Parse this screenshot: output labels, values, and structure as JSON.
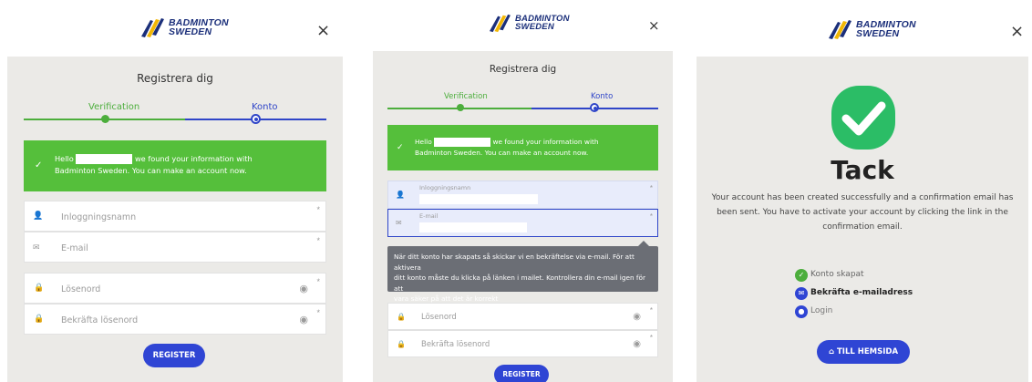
{
  "brand": {
    "line1": "BADMINTON",
    "line2": "SWEDEN"
  },
  "close_symbol": "×",
  "panel1": {
    "title": "Registrera dig",
    "steps": [
      "Verification",
      "Konto"
    ],
    "alert": {
      "pre": "Hello",
      "post": "we found your information with",
      "line2": "Badminton Sweden. You can make an account now."
    },
    "fields": {
      "username": "Inloggningsnamn",
      "email": "E-mail",
      "password": "Lösenord",
      "confirm": "Bekräfta lösenord"
    },
    "button": "REGISTER"
  },
  "panel2": {
    "title": "Registrera dig",
    "steps": [
      "Verification",
      "Konto"
    ],
    "alert": {
      "pre": "Hello",
      "post": "we found your information with",
      "line2": "Badminton Sweden. You can make an account now."
    },
    "fields": {
      "username": "Inloggningsnamn",
      "email": "E-mail",
      "password": "Lösenord",
      "confirm": "Bekräfta lösenord"
    },
    "tooltip": [
      "När ditt konto har skapats så skickar vi en bekräftelse via e-mail. För att aktivera",
      "ditt konto måste du klicka på länken i mailet. Kontrollera din e-mail igen för att",
      "vara säker på att det är korrekt"
    ],
    "button": "REGISTER"
  },
  "panel3": {
    "heading": "Tack",
    "message": [
      "Your account has been created successfully and a confirmation email has",
      "been sent. You have to activate your account by clicking the link in the",
      "confirmation email."
    ],
    "checklist": [
      "Konto skapat",
      "Bekräfta e-mailadress",
      "Login"
    ],
    "button": "TILL HEMSIDA"
  },
  "colors": {
    "green": "#4cae3c",
    "alert_green": "#55bf3b",
    "blue": "#2f45d4",
    "navy": "#1b2f7a",
    "panel_bg": "#ebeae7"
  },
  "icons": [
    "badminton-logo-icon",
    "close-icon",
    "check-icon",
    "user-icon",
    "email-icon",
    "lock-icon",
    "eye-icon",
    "home-icon"
  ]
}
